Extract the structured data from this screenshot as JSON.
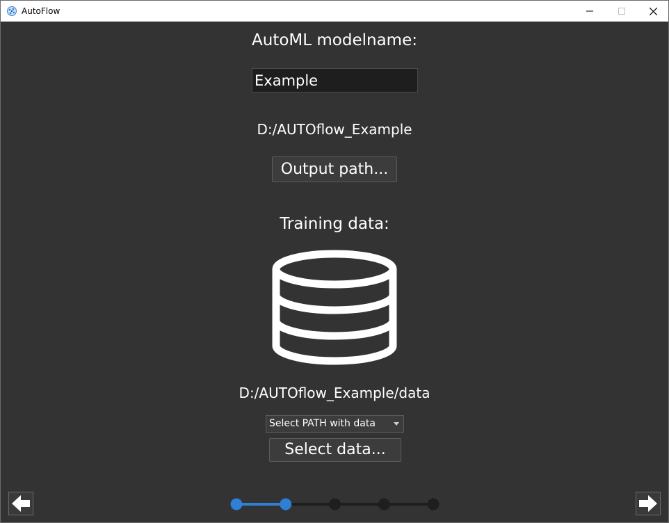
{
  "window": {
    "title": "AutoFlow",
    "controls": [
      "minimize-icon",
      "maximize-icon",
      "close-icon"
    ]
  },
  "main": {
    "model_name_label": "AutoML modelname:",
    "model_name_value": "Example",
    "output_path_value": "D:/AUTOflow_Example",
    "output_path_button": "Output path...",
    "training_data_label": "Training data:",
    "training_icon": "database-icon",
    "data_path_value": "D:/AUTOflow_Example/data",
    "data_mode_select": {
      "selected": "Select PATH with data"
    },
    "select_data_button": "Select data..."
  },
  "navigation": {
    "back_icon": "arrow-left-icon",
    "next_icon": "arrow-right-icon",
    "steps_total": 5,
    "steps_done": 2
  },
  "colors": {
    "background": "#333333",
    "accent": "#2f7fd6",
    "step_inactive": "#1e1e1e"
  }
}
